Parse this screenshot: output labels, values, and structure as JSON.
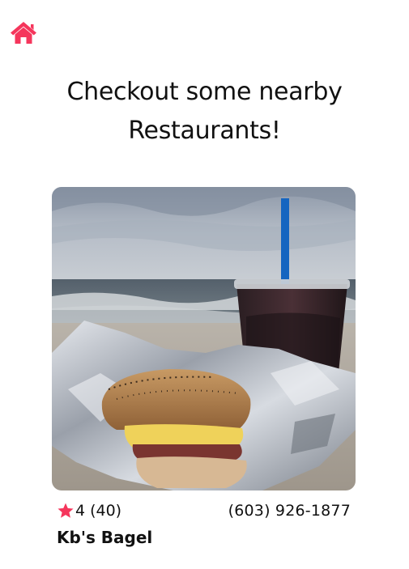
{
  "nav": {
    "home_icon": "home-icon",
    "home_color": "#f5365c"
  },
  "page": {
    "heading_line1": "Checkout some nearby",
    "heading_line2": "Restaurants!"
  },
  "restaurants": [
    {
      "name": "Kb's Bagel",
      "rating": "4",
      "review_count": "(40)",
      "phone": "(603) 926-1877",
      "star_icon": "star-icon",
      "star_color": "#f5365c"
    }
  ]
}
